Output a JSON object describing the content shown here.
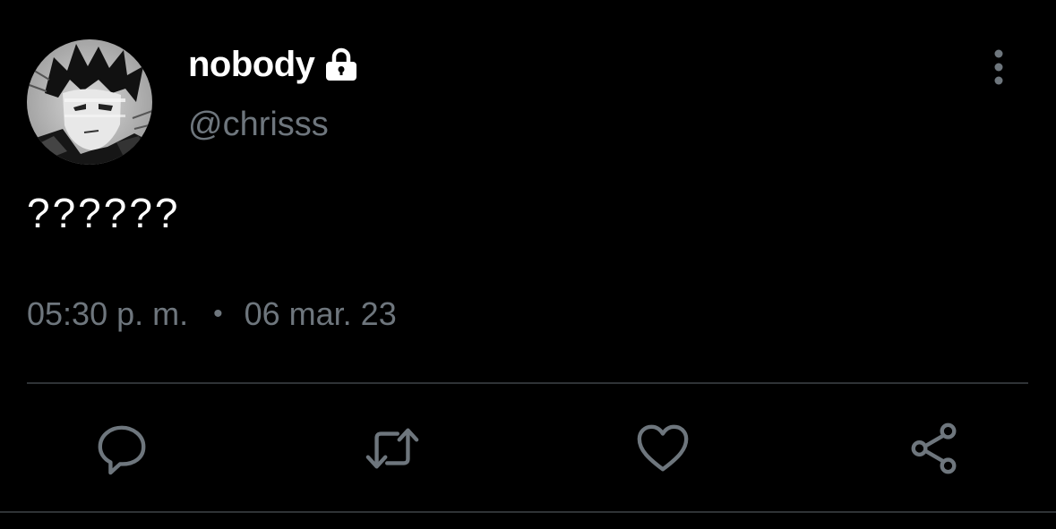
{
  "user": {
    "display_name": "nobody",
    "handle": "@chrisss",
    "protected_icon": "lock-icon",
    "avatar_icon": "manga-avatar"
  },
  "tweet": {
    "text": "??????",
    "time": "05:30 p. m.",
    "separator": "•",
    "date": "06 mar. 23"
  },
  "actions": [
    {
      "name": "reply",
      "icon": "reply-icon"
    },
    {
      "name": "retweet",
      "icon": "retweet-icon"
    },
    {
      "name": "like",
      "icon": "heart-icon"
    },
    {
      "name": "share",
      "icon": "share-icon"
    }
  ],
  "colors": {
    "background": "#000000",
    "primary_text": "#ffffff",
    "secondary_text": "#6e767d",
    "icon": "#6e767d",
    "divider": "#2f3336"
  }
}
